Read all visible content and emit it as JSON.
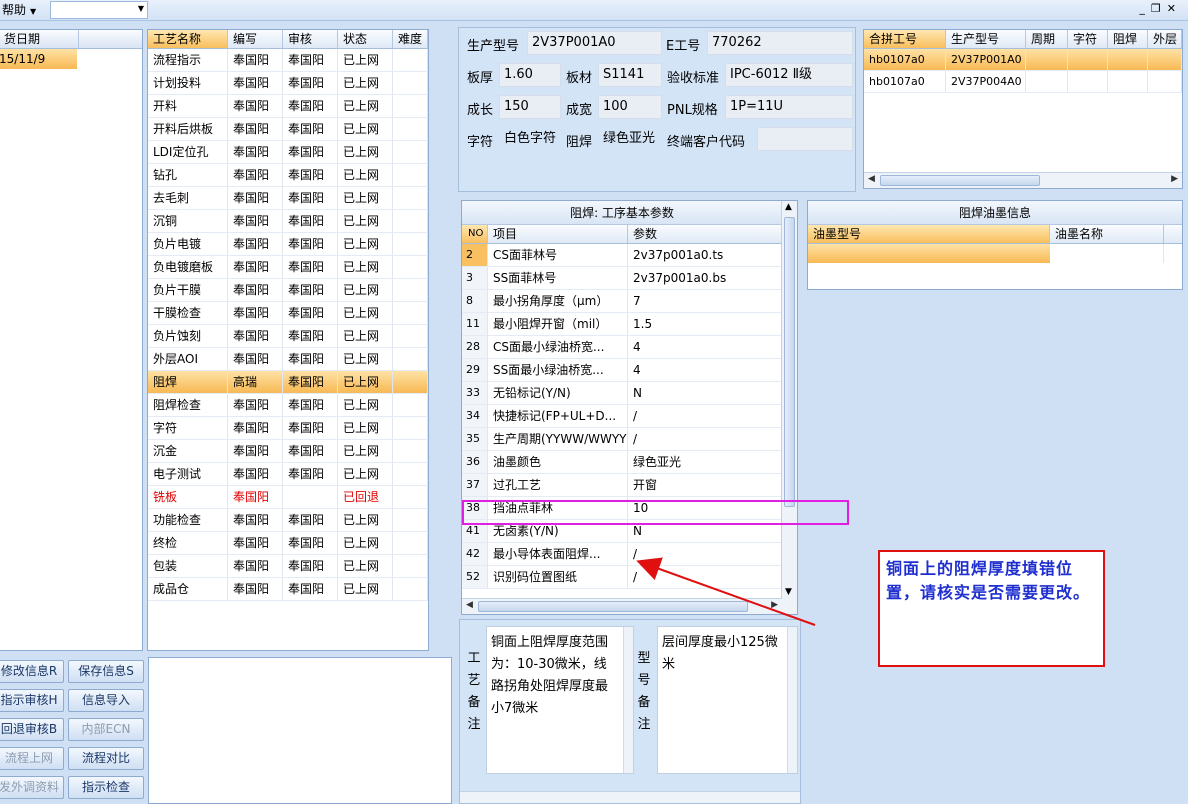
{
  "menu": {
    "help": "帮助"
  },
  "date_panel": {
    "header": "货日期",
    "value": "15/11/9"
  },
  "process": {
    "columns": [
      "工艺名称",
      "编写",
      "审核",
      "状态",
      "难度"
    ],
    "rows": [
      {
        "name": "流程指示",
        "author": "奉国阳",
        "reviewer": "奉国阳",
        "status": "已上网",
        "difficulty": ""
      },
      {
        "name": "计划投料",
        "author": "奉国阳",
        "reviewer": "奉国阳",
        "status": "已上网",
        "difficulty": ""
      },
      {
        "name": "开料",
        "author": "奉国阳",
        "reviewer": "奉国阳",
        "status": "已上网",
        "difficulty": ""
      },
      {
        "name": "开料后烘板",
        "author": "奉国阳",
        "reviewer": "奉国阳",
        "status": "已上网",
        "difficulty": ""
      },
      {
        "name": "LDI定位孔",
        "author": "奉国阳",
        "reviewer": "奉国阳",
        "status": "已上网",
        "difficulty": ""
      },
      {
        "name": "钻孔",
        "author": "奉国阳",
        "reviewer": "奉国阳",
        "status": "已上网",
        "difficulty": ""
      },
      {
        "name": "去毛刺",
        "author": "奉国阳",
        "reviewer": "奉国阳",
        "status": "已上网",
        "difficulty": ""
      },
      {
        "name": "沉铜",
        "author": "奉国阳",
        "reviewer": "奉国阳",
        "status": "已上网",
        "difficulty": ""
      },
      {
        "name": "负片电镀",
        "author": "奉国阳",
        "reviewer": "奉国阳",
        "status": "已上网",
        "difficulty": ""
      },
      {
        "name": "负电镀磨板",
        "author": "奉国阳",
        "reviewer": "奉国阳",
        "status": "已上网",
        "difficulty": ""
      },
      {
        "name": "负片干膜",
        "author": "奉国阳",
        "reviewer": "奉国阳",
        "status": "已上网",
        "difficulty": ""
      },
      {
        "name": "干膜检查",
        "author": "奉国阳",
        "reviewer": "奉国阳",
        "status": "已上网",
        "difficulty": ""
      },
      {
        "name": "负片蚀刻",
        "author": "奉国阳",
        "reviewer": "奉国阳",
        "status": "已上网",
        "difficulty": ""
      },
      {
        "name": "外层AOI",
        "author": "奉国阳",
        "reviewer": "奉国阳",
        "status": "已上网",
        "difficulty": ""
      },
      {
        "name": "阻焊",
        "author": "高瑞",
        "reviewer": "奉国阳",
        "status": "已上网",
        "difficulty": "",
        "selected": true
      },
      {
        "name": "阻焊检查",
        "author": "奉国阳",
        "reviewer": "奉国阳",
        "status": "已上网",
        "difficulty": ""
      },
      {
        "name": "字符",
        "author": "奉国阳",
        "reviewer": "奉国阳",
        "status": "已上网",
        "difficulty": ""
      },
      {
        "name": "沉金",
        "author": "奉国阳",
        "reviewer": "奉国阳",
        "status": "已上网",
        "difficulty": ""
      },
      {
        "name": "电子测试",
        "author": "奉国阳",
        "reviewer": "奉国阳",
        "status": "已上网",
        "difficulty": ""
      },
      {
        "name": "铣板",
        "author": "奉国阳",
        "reviewer": "",
        "status": "已回退",
        "difficulty": "",
        "red": true
      },
      {
        "name": "功能检查",
        "author": "奉国阳",
        "reviewer": "奉国阳",
        "status": "已上网",
        "difficulty": ""
      },
      {
        "name": "终检",
        "author": "奉国阳",
        "reviewer": "奉国阳",
        "status": "已上网",
        "difficulty": ""
      },
      {
        "name": "包装",
        "author": "奉国阳",
        "reviewer": "奉国阳",
        "status": "已上网",
        "difficulty": ""
      },
      {
        "name": "成品仓",
        "author": "奉国阳",
        "reviewer": "奉国阳",
        "status": "已上网",
        "difficulty": ""
      }
    ]
  },
  "buttons": {
    "edit_info": "修改信息R",
    "save_info": "保存信息S",
    "review": "指示审核H",
    "import_info": "信息导入",
    "rollback_review": "回退审核B",
    "internal_ecn": "内部ECN",
    "flow_online": "流程上网",
    "flow_compare": "流程对比",
    "outsource": "发外调资料",
    "check": "指示检查"
  },
  "info": {
    "model_label": "生产型号",
    "model_value": "2V37P001A0",
    "eno_label": "E工号",
    "eno_value": "770262",
    "thick_label": "板厚",
    "thick_value": "1.60",
    "material_label": "板材",
    "material_value": "S1141",
    "standard_label": "验收标准",
    "standard_value": "IPC-6012 Ⅱ级",
    "length_label": "成长",
    "length_value": "150",
    "width_label": "成宽",
    "width_value": "100",
    "pnl_label": "PNL规格",
    "pnl_value": "1P=11U",
    "char_label": "字符",
    "char_value": "白色字符",
    "mask_label": "阻焊",
    "mask_value": "绿色亚光",
    "customer_label": "终端客户代码",
    "customer_value": ""
  },
  "merge": {
    "columns": [
      "合拼工号",
      "生产型号",
      "周期",
      "字符",
      "阻焊",
      "外层"
    ],
    "rows": [
      [
        "hb0107a0",
        "2V37P001A0",
        "",
        "",
        "",
        ""
      ],
      [
        "hb0107a0",
        "2V37P004A0",
        "",
        "",
        "",
        ""
      ]
    ]
  },
  "params": {
    "title": "阻焊: 工序基本参数",
    "columns": [
      "NO",
      "项目",
      "参数"
    ],
    "rows": [
      [
        "2",
        "CS面菲林号",
        "2v37p001a0.ts"
      ],
      [
        "3",
        "SS面菲林号",
        "2v37p001a0.bs"
      ],
      [
        "8",
        "最小拐角厚度（μm）",
        "7"
      ],
      [
        "11",
        "最小阻焊开窗（mil）",
        "1.5"
      ],
      [
        "28",
        "CS面最小绿油桥宽...",
        "4"
      ],
      [
        "29",
        "SS面最小绿油桥宽...",
        "4"
      ],
      [
        "33",
        "无铅标记(Y/N)",
        "N"
      ],
      [
        "34",
        "快捷标记(FP+UL+D...",
        "/"
      ],
      [
        "35",
        "生产周期(YYWW/WWYY)",
        "/"
      ],
      [
        "36",
        "油墨颜色",
        "绿色亚光"
      ],
      [
        "37",
        "过孔工艺",
        "开窗"
      ],
      [
        "38",
        "挡油点菲林",
        "10"
      ],
      [
        "41",
        "无卤素(Y/N)",
        "N"
      ],
      [
        "42",
        "最小导体表面阻焊...",
        "/"
      ],
      [
        "52",
        "识别码位置图纸",
        "/"
      ]
    ]
  },
  "ink": {
    "title": "阻焊油墨信息",
    "columns": [
      "油墨型号",
      "油墨名称"
    ]
  },
  "remarks": {
    "process_label": "工艺备注",
    "process_text": "铜面上阻焊厚度范围为：10-30微米，线路拐角处阻焊厚度最小7微米",
    "model_label": "型号备注",
    "model_text": "层间厚度最小125微米"
  },
  "annotation": {
    "note": "铜面上的阻焊厚度填错位置，请核实是否需要更改。",
    "highlight_color": "#e020e0",
    "arrow_color": "#e01010"
  }
}
